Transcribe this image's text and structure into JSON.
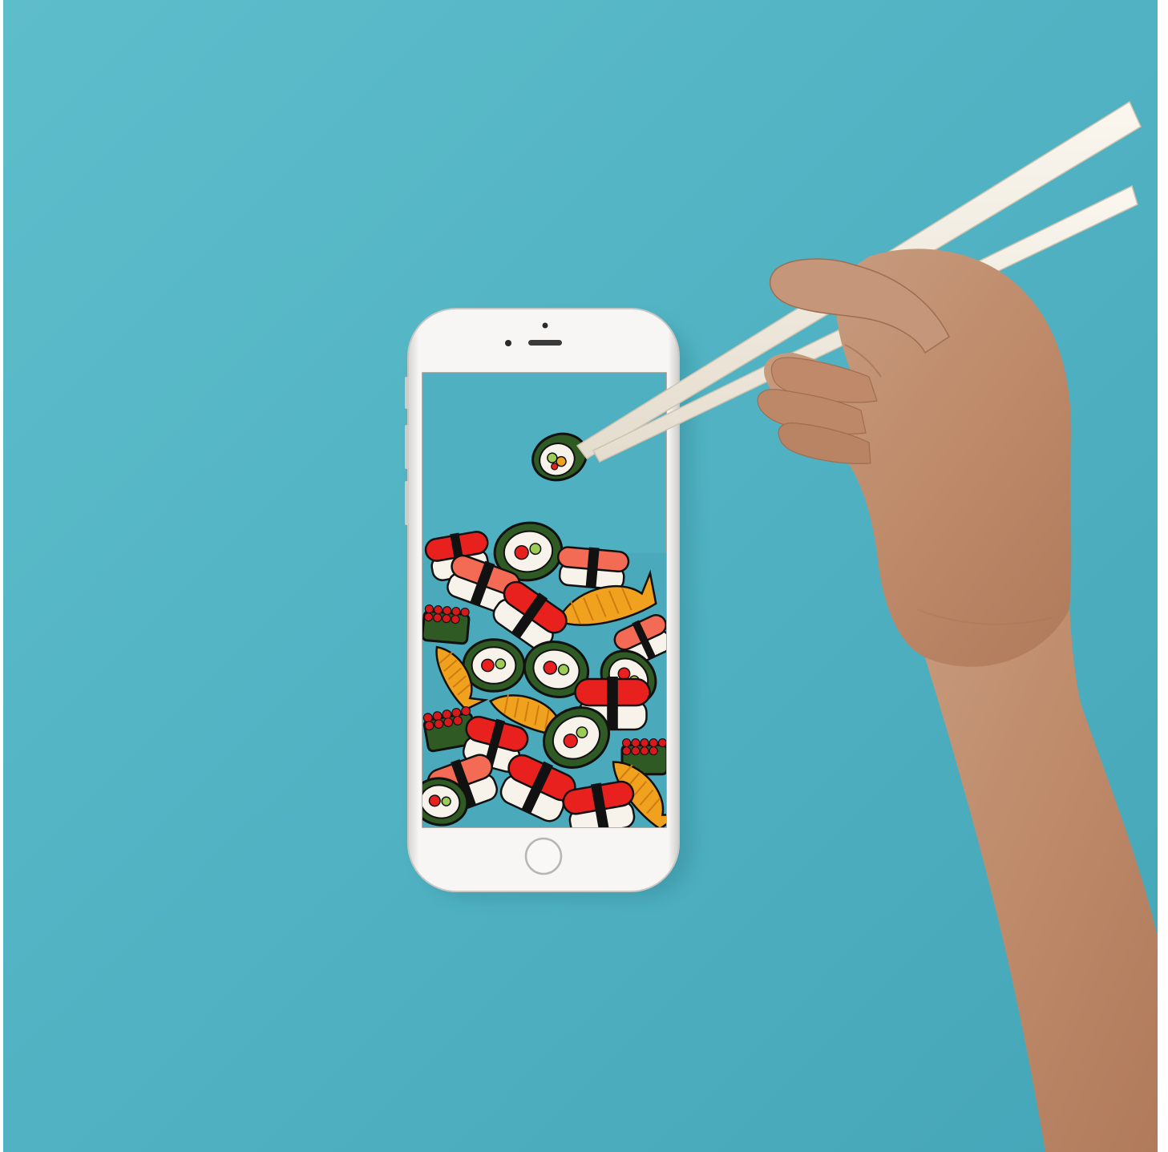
{
  "scene": {
    "background_color": "#52b4c4",
    "wallpaper_color": "#4fb0c2",
    "phone_body_color": "#f4f3f1",
    "phone_rim_color": "#d9d7d4",
    "chopstick_color": "#f3ece0",
    "skin_color": "#c08a6a",
    "sushi_palette": {
      "nori": "#2f5a24",
      "rice": "#f7f3ea",
      "salmon": "#f36b55",
      "tuna_red": "#e8201e",
      "shrimp_orange": "#f0a21f",
      "roe_red": "#d8191c",
      "avocado": "#9ccc55",
      "tamago_yellow": "#f2c94c",
      "outline": "#111111"
    },
    "objects": {
      "phone": "phone",
      "earpiece": "earpiece-icon",
      "front_camera": "camera-icon",
      "home_button": "home-button-icon",
      "hand": "hand",
      "chopsticks": "chopsticks",
      "held_roll": "sushi-roll-held",
      "pile": "sushi-pile"
    }
  }
}
